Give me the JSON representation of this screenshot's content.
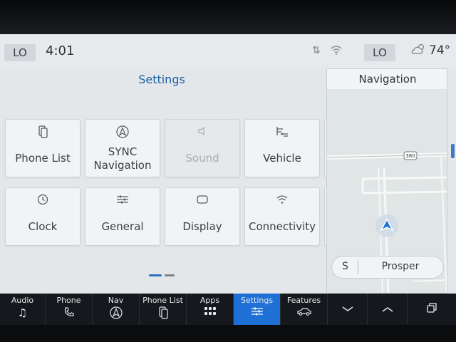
{
  "status_bar": {
    "left_climate": "LO",
    "time": "4:01",
    "right_climate": "LO",
    "temperature": "74°",
    "icons": [
      "data-arrows-icon",
      "wifi-icon",
      "weather-icon"
    ]
  },
  "settings": {
    "title": "Settings",
    "tiles": [
      {
        "label": "Phone List",
        "icon": "phone-list-icon",
        "enabled": true
      },
      {
        "label": "SYNC Navigation",
        "line1": "SYNC",
        "line2": "Navigation",
        "icon": "navigation-icon",
        "enabled": true
      },
      {
        "label": "Sound",
        "icon": "speaker-icon",
        "enabled": false
      },
      {
        "label": "Vehicle",
        "icon": "vehicle-icon",
        "enabled": true
      },
      {
        "label": "Clock",
        "icon": "clock-icon",
        "enabled": true
      },
      {
        "label": "General",
        "icon": "sliders-icon",
        "enabled": true
      },
      {
        "label": "Display",
        "icon": "display-icon",
        "enabled": true
      },
      {
        "label": "Connectivity",
        "icon": "wifi-icon",
        "enabled": true
      }
    ],
    "pages": 2,
    "current_page": 1
  },
  "navigation": {
    "title": "Navigation",
    "road_shield": "380",
    "street_direction": "S",
    "street_name": "Prosper"
  },
  "nav_bar": {
    "items": [
      {
        "label": "Audio",
        "icon": "music-icon"
      },
      {
        "label": "Phone",
        "icon": "phone-icon"
      },
      {
        "label": "Nav",
        "icon": "navigation-icon"
      },
      {
        "label": "Phone List",
        "icon": "phone-list-icon"
      },
      {
        "label": "Apps",
        "icon": "apps-grid-icon"
      },
      {
        "label": "Settings",
        "icon": "settings-sliders-icon",
        "active": true
      },
      {
        "label": "Features",
        "icon": "car-icon"
      }
    ],
    "extra_icons": [
      "chevron-down-icon",
      "chevron-up-icon",
      "multiwindow-icon"
    ]
  },
  "colors": {
    "accent": "#1e6fd6",
    "title_blue": "#1f5fa8",
    "nav_bar_bg": "#15181c"
  }
}
